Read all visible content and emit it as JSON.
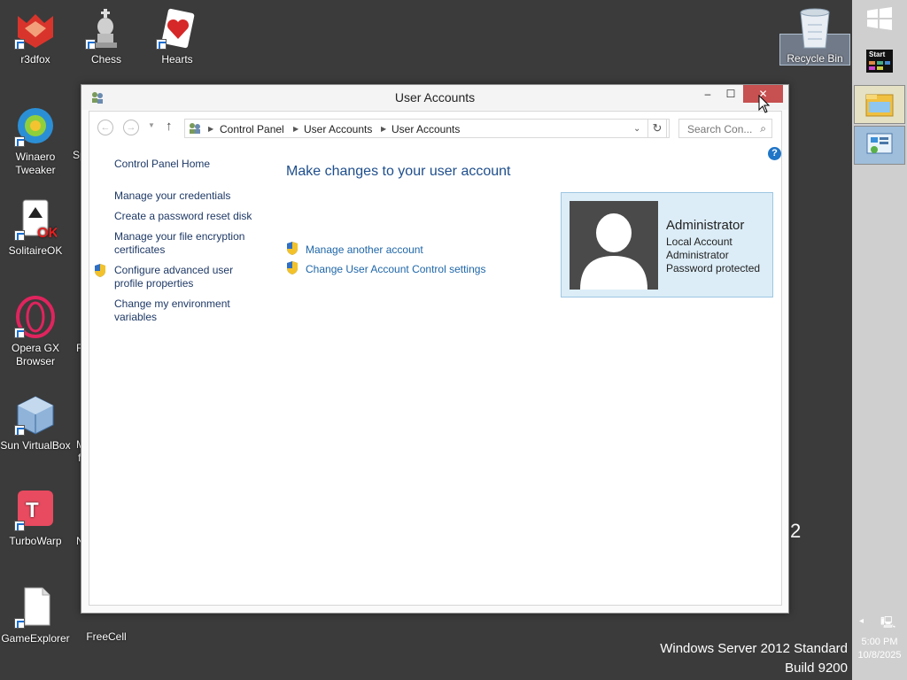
{
  "desktop": {
    "icons": [
      {
        "label": "r3dfox"
      },
      {
        "label": "Chess"
      },
      {
        "label": "Hearts"
      },
      {
        "label": "Recycle Bin"
      },
      {
        "label": "Winaero Tweaker"
      },
      {
        "label": "SolitaireOK"
      },
      {
        "label": "Opera GX Browser"
      },
      {
        "label": "Sun VirtualBox"
      },
      {
        "label": "TurboWarp"
      },
      {
        "label": "GameExplorer"
      },
      {
        "label": "FreeCell"
      }
    ],
    "partial_labels": [
      "Sp",
      "F",
      "M",
      "f",
      "N"
    ]
  },
  "watermark": {
    "line1": "Windows Server 2012 Standard",
    "line2": "Build 9200",
    "partial": "2"
  },
  "tray": {
    "time": "5:00 PM",
    "date": "10/8/2025",
    "start_label": "Start"
  },
  "window": {
    "title": "User Accounts",
    "minimize_glyph": "–",
    "maximize_glyph": "☐",
    "close_glyph": "✕",
    "address": {
      "segments": [
        "Control Panel",
        "User Accounts",
        "User Accounts"
      ]
    },
    "search_placeholder": "Search Con...",
    "left_tasks": {
      "home": "Control Panel Home",
      "credentials": "Manage your credentials",
      "reset_disk": "Create a password reset disk",
      "encryption_line1": "Manage your file encryption",
      "encryption_line2": "certificates",
      "profile_line1": "Configure advanced user",
      "profile_line2": "profile properties",
      "env_line1": "Change my environment",
      "env_line2": "variables"
    },
    "main": {
      "heading": "Make changes to your user account",
      "links": {
        "manage_another": "Manage another account",
        "uac": "Change User Account Control settings"
      },
      "user": {
        "name": "Administrator",
        "type": "Local Account",
        "group": "Administrator",
        "status": "Password protected"
      },
      "help_glyph": "?"
    }
  },
  "colors": {
    "desktop_bg": "#3b3b3b",
    "close_button": "#c75050",
    "link": "#1e66a8",
    "heading": "#1e4e8c",
    "user_card": "#dcedf7"
  }
}
